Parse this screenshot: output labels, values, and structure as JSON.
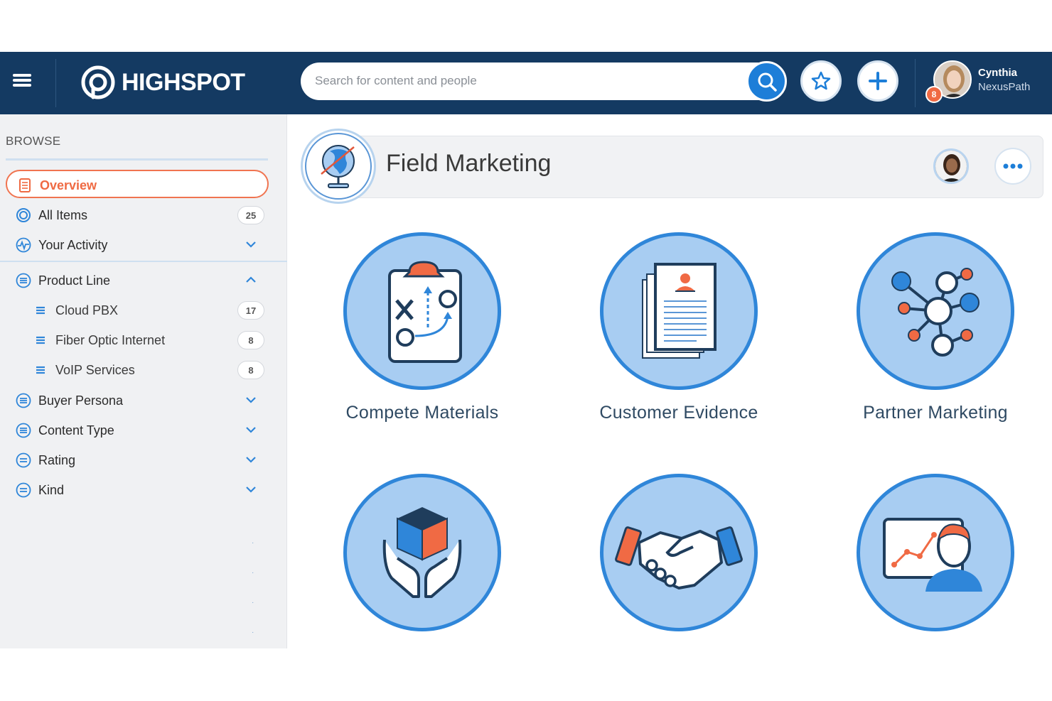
{
  "header": {
    "logo_text": "HIGHSPOT",
    "search_placeholder": "Search for content and people",
    "user": {
      "first_name": "Cynthia",
      "last_name": "NexusPath",
      "notifications": "8"
    }
  },
  "sidebar": {
    "heading": "BROWSE",
    "items": [
      {
        "label": "Overview",
        "icon": "overview-icon"
      },
      {
        "label": "All Items",
        "count": "25",
        "icon": "all-items-icon"
      },
      {
        "label": "Your Activity",
        "icon": "activity-icon"
      },
      {
        "label": "Product Line",
        "icon": "list-icon"
      },
      {
        "label": "Cloud PBX",
        "count": "17",
        "icon": "list-icon"
      },
      {
        "label": "Fiber Optic Internet",
        "count": "8",
        "icon": "list-icon"
      },
      {
        "label": "VoIP Services",
        "count": "8",
        "icon": "list-icon"
      },
      {
        "label": "Buyer Persona",
        "icon": "list-icon"
      },
      {
        "label": "Content Type",
        "icon": "list-icon"
      },
      {
        "label": "Rating",
        "icon": "list-icon"
      },
      {
        "label": "Kind",
        "icon": "list-icon"
      }
    ]
  },
  "main": {
    "title": "Field Marketing",
    "tiles": [
      {
        "label": "Compete Materials",
        "icon": "clipboard-strategy-icon"
      },
      {
        "label": "Customer Evidence",
        "icon": "documents-icon"
      },
      {
        "label": "Partner Marketing",
        "icon": "network-icon"
      },
      {
        "label": "",
        "icon": "hands-cube-icon"
      },
      {
        "label": "",
        "icon": "handshake-icon"
      },
      {
        "label": "",
        "icon": "presenter-chart-icon"
      }
    ]
  },
  "colors": {
    "topbar": "#143a62",
    "accent": "#1d7ed8",
    "orange": "#ef6a43",
    "tile_fill": "#a8cdf2"
  }
}
